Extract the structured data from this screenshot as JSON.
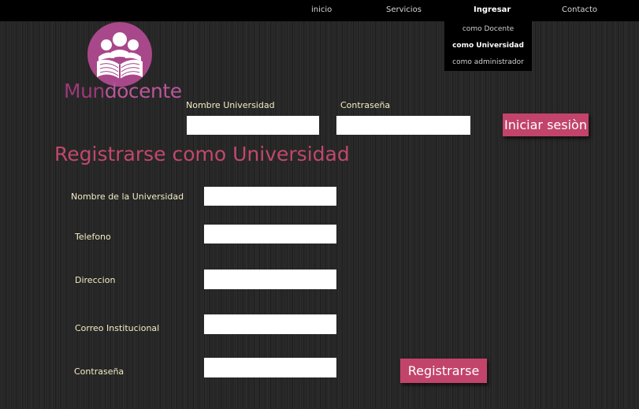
{
  "nav": {
    "items": [
      {
        "label": "inicio"
      },
      {
        "label": "Servicios"
      },
      {
        "label": "Ingresar"
      },
      {
        "label": "Contacto"
      }
    ],
    "dropdown": [
      {
        "label": "como Docente"
      },
      {
        "label": "como Universidad"
      },
      {
        "label": "como administrador"
      }
    ]
  },
  "logo": {
    "text_part1": "Mun",
    "text_part2": "docente",
    "color": "#a8488a"
  },
  "login": {
    "university_label": "Nombre Universidad",
    "password_label": "Contraseña",
    "university_value": "",
    "password_value": "",
    "submit_label": "Iniciar sesiòn"
  },
  "register": {
    "title": "Registrarse como Universidad",
    "fields": [
      {
        "label": "Nombre de la Universidad",
        "value": ""
      },
      {
        "label": "Telefono",
        "value": ""
      },
      {
        "label": "Direccion",
        "value": ""
      },
      {
        "label": "Correo Institucional",
        "value": ""
      },
      {
        "label": "Contraseña",
        "value": ""
      }
    ],
    "submit_label": "Registrarse"
  },
  "colors": {
    "accent": "#c2446b",
    "label_text": "#f4ecc4",
    "background": "#262626"
  }
}
